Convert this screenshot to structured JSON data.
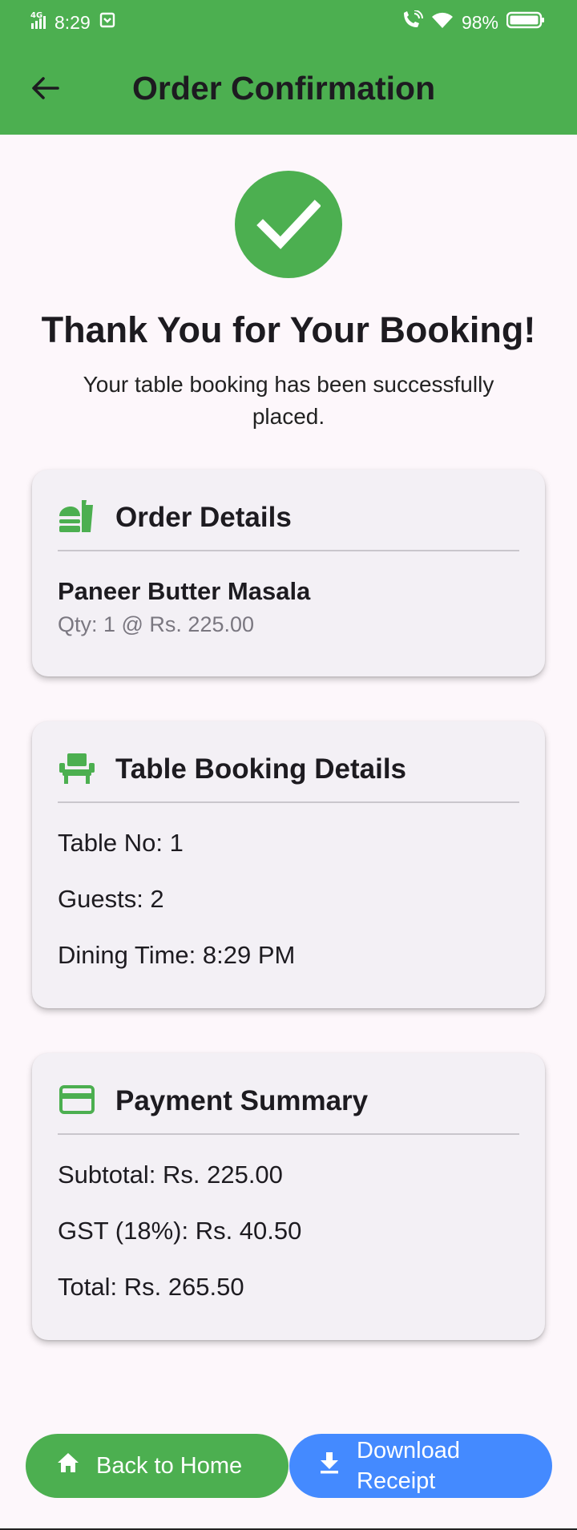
{
  "status_bar": {
    "network": "4G",
    "time": "8:29",
    "battery": "98%"
  },
  "app_bar": {
    "title": "Order Confirmation",
    "back_icon": "arrow-back-icon"
  },
  "confirmation": {
    "icon": "check-circle-icon",
    "heading": "Thank You for Your Booking!",
    "message": "Your table booking has been successfully placed."
  },
  "order_details": {
    "title": "Order Details",
    "icon": "fastfood-icon",
    "items": [
      {
        "name": "Paneer Butter Masala",
        "detail": "Qty: 1 @ Rs. 225.00"
      }
    ]
  },
  "table_booking": {
    "title": "Table Booking Details",
    "icon": "chair-icon",
    "lines": [
      "Table No: 1",
      "Guests: 2",
      "Dining Time: 8:29 PM"
    ]
  },
  "payment": {
    "title": "Payment Summary",
    "icon": "credit-card-icon",
    "lines": [
      "Subtotal: Rs. 225.00",
      "GST (18%): Rs. 40.50",
      "Total: Rs. 265.50"
    ]
  },
  "actions": {
    "home_label": "Back to Home",
    "home_icon": "home-icon",
    "download_label": "Download Receipt",
    "download_icon": "download-icon"
  },
  "colors": {
    "primary_green": "#4caf50",
    "accent_blue": "#448aff",
    "background": "#fdf7fb",
    "card": "#f3f0f5"
  }
}
